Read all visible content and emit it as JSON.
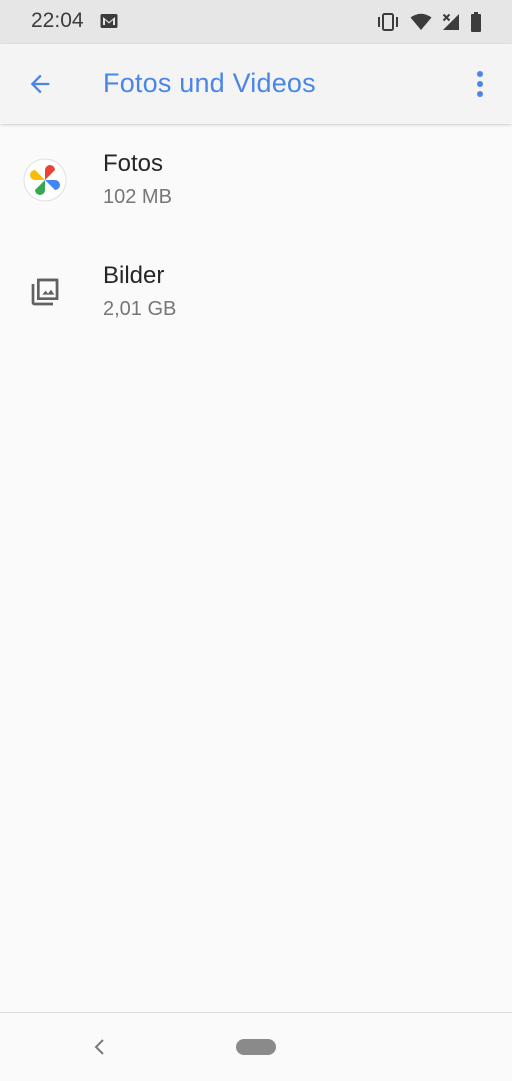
{
  "status_bar": {
    "time": "22:04",
    "icons": [
      "gmail-icon",
      "vibrate-icon",
      "wifi-icon",
      "cell-signal-icon",
      "battery-icon"
    ]
  },
  "app_bar": {
    "title": "Fotos und Videos",
    "accent_color": "#4a86e8"
  },
  "items": [
    {
      "title": "Fotos",
      "subtitle": "102 MB",
      "icon": "google-photos-icon"
    },
    {
      "title": "Bilder",
      "subtitle": "2,01 GB",
      "icon": "image-collection-icon"
    }
  ],
  "nav_bar": {
    "icons": [
      "nav-back-icon",
      "home-pill"
    ]
  }
}
